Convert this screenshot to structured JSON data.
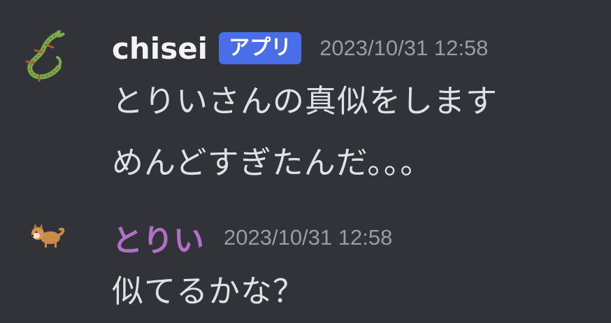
{
  "messages": [
    {
      "username": "chisei",
      "badge": "アプリ",
      "timestamp": "2023/10/31 12:58",
      "lines": [
        "とりいさんの真似をします",
        "めんどすぎたんだ。。。"
      ]
    },
    {
      "username": "とりい",
      "timestamp": "2023/10/31 12:58",
      "lines": [
        "似てるかな？"
      ]
    }
  ],
  "colors": {
    "background": "#313338",
    "username_primary": "#f2f3f5",
    "username_secondary": "#b26ec9",
    "badge_bg": "#4a6ee8",
    "timestamp": "#9a9ca3",
    "message_text": "#e0e1e5"
  },
  "icons": {
    "avatar_1": "gecko-avatar-icon",
    "avatar_2": "shiba-dog-avatar-icon"
  }
}
